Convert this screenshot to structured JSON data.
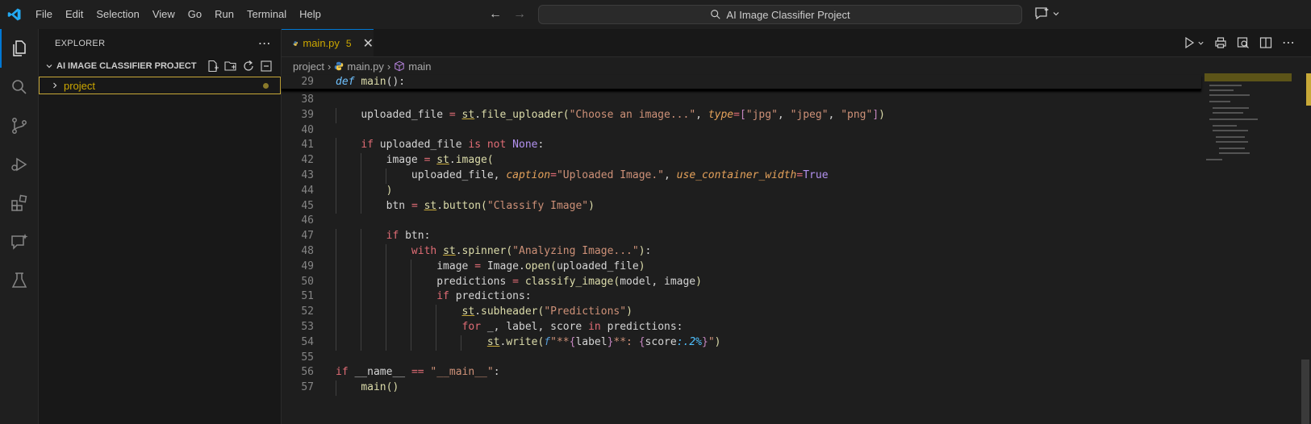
{
  "menu": [
    "File",
    "Edit",
    "Selection",
    "View",
    "Go",
    "Run",
    "Terminal",
    "Help"
  ],
  "search": {
    "text": "AI Image Classifier Project"
  },
  "sidebar": {
    "title": "EXPLORER",
    "section": "AI IMAGE CLASSIFIER PROJECT",
    "items": [
      {
        "label": "project"
      }
    ]
  },
  "tab": {
    "name": "main.py",
    "problems": "5"
  },
  "breadcrumb": {
    "folder": "project",
    "file": "main.py",
    "symbol": "main"
  },
  "code": {
    "sticky": {
      "num": "29",
      "text": "def main():"
    },
    "lines": [
      {
        "num": "38",
        "text": ""
      },
      {
        "num": "39",
        "text": "    uploaded_file = st.file_uploader(\"Choose an image...\", type=[\"jpg\", \"jpeg\", \"png\"])"
      },
      {
        "num": "40",
        "text": ""
      },
      {
        "num": "41",
        "text": "    if uploaded_file is not None:"
      },
      {
        "num": "42",
        "text": "        image = st.image("
      },
      {
        "num": "43",
        "text": "            uploaded_file, caption=\"Uploaded Image.\", use_container_width=True"
      },
      {
        "num": "44",
        "text": "        )"
      },
      {
        "num": "45",
        "text": "        btn = st.button(\"Classify Image\")"
      },
      {
        "num": "46",
        "text": ""
      },
      {
        "num": "47",
        "text": "        if btn:"
      },
      {
        "num": "48",
        "text": "            with st.spinner(\"Analyzing Image...\"):"
      },
      {
        "num": "49",
        "text": "                image = Image.open(uploaded_file)"
      },
      {
        "num": "50",
        "text": "                predictions = classify_image(model, image)"
      },
      {
        "num": "51",
        "text": "                if predictions:"
      },
      {
        "num": "52",
        "text": "                    st.subheader(\"Predictions\")"
      },
      {
        "num": "53",
        "text": "                    for _, label, score in predictions:"
      },
      {
        "num": "54",
        "text": "                        st.write(f\"**{label}**: {score:.2%}\")"
      },
      {
        "num": "55",
        "text": ""
      },
      {
        "num": "56",
        "text": "if __name__ == \"__main__\":"
      },
      {
        "num": "57",
        "text": "    main()"
      }
    ]
  },
  "colors": {
    "accent": "#0078d4",
    "modified": "#cca700"
  }
}
